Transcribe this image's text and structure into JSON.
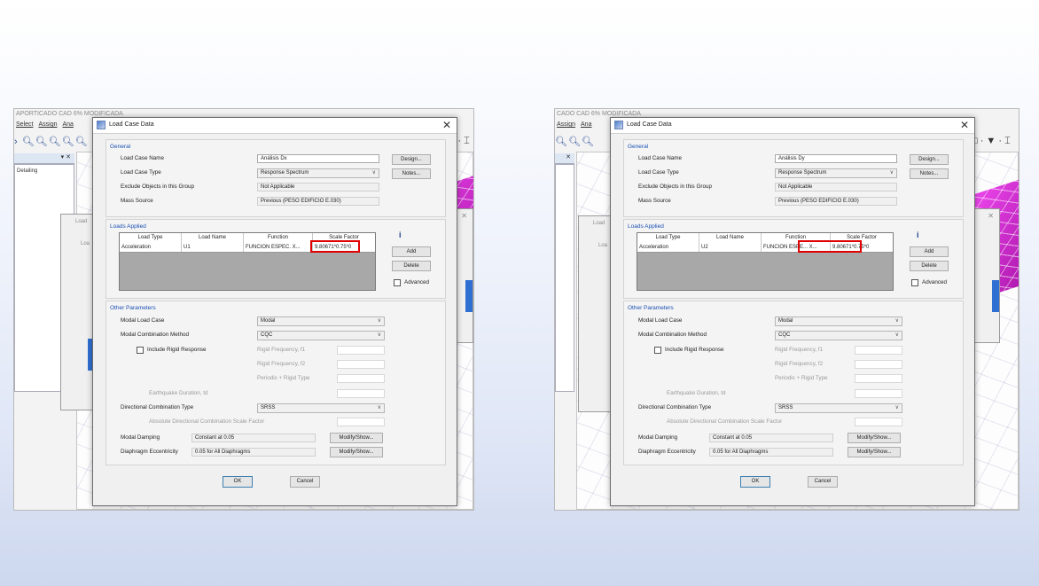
{
  "left": {
    "app": {
      "title": "APORTICADO CAD 6% MODIFICADA",
      "menu": [
        "Select",
        "Assign",
        "Ana"
      ],
      "panel_close": "▾ ✕",
      "tree_item": "Detailing",
      "toolbar_icons": "› 🔍︎🔍︎🔍︎🔍︎🔍︎",
      "toolbar_right": "□ · ▼ · ⌶ · ss",
      "bg_dialog_title": "Load",
      "bg_dialog_sub": "Loa"
    },
    "dialog": {
      "title": "Load Case Data",
      "close": "✕",
      "general": {
        "title": "General",
        "case_name_label": "Load Case Name",
        "case_name": "Análisis Dx",
        "case_type_label": "Load Case Type",
        "case_type": "Response Spectrum",
        "exclude_label": "Exclude Objects in this Group",
        "exclude_value": "Not Applicable",
        "mass_label": "Mass Source",
        "mass_value": "Previous (PESO EDIFICIO E.030)",
        "design_button": "Design...",
        "notes_button": "Notes..."
      },
      "loads": {
        "title": "Loads Applied",
        "headers": [
          "Load Type",
          "Load Name",
          "Function",
          "Scale Factor"
        ],
        "row": [
          "Acceleration",
          "U1",
          "FUNCION ESPEC. X...",
          "9.80671*0.75*0"
        ],
        "add_button": "Add",
        "delete_button": "Delete",
        "advanced_label": "Advanced",
        "info_icon": "i"
      },
      "other": {
        "title": "Other Parameters",
        "modal_case_label": "Modal Load Case",
        "modal_case": "Modal",
        "modal_comb_label": "Modal Combination Method",
        "modal_comb": "CQC",
        "rigid_label": "Include Rigid Response",
        "rigid_f1": "Rigid Frequency, f1",
        "rigid_f2": "Rigid Frequency, f2",
        "periodic_rigid": "Periodic + Rigid Type",
        "eq_duration": "Earthquake Duration, td",
        "dir_comb_label": "Directional Combination Type",
        "dir_comb": "SRSS",
        "abs_scale": "Absolute Directional Combination Scale Factor",
        "damping_label": "Modal Damping",
        "damping_value": "Constant at 0.05",
        "ecc_label": "Diaphragm Eccentricity",
        "ecc_value": "0.05 for All Diaphragms",
        "modify_button": "Modify/Show...",
        "modify_button2": "Modify/Show..."
      },
      "ok_button": "OK",
      "cancel_button": "Cancel"
    }
  },
  "right": {
    "app": {
      "title": "CADO CAD 6% MODIFICADA",
      "menu": [
        "Assign",
        "Ana"
      ],
      "panel_close": "✕",
      "toolbar_icons": "🔍︎🔍︎🔍︎",
      "toolbar_right": "□ · ▼ · ⌶",
      "bg_dialog_title": "Load",
      "bg_dialog_sub": "Loa"
    },
    "dialog": {
      "title": "Load Case Data",
      "close": "✕",
      "general": {
        "title": "General",
        "case_name_label": "Load Case Name",
        "case_name": "Análisis Dy",
        "case_type_label": "Load Case Type",
        "case_type": "Response Spectrum",
        "exclude_label": "Exclude Objects in this Group",
        "exclude_value": "Not Applicable",
        "mass_label": "Mass Source",
        "mass_value": "Previous (PESO EDIFICIO E.030)",
        "design_button": "Design...",
        "notes_button": "Notes..."
      },
      "loads": {
        "title": "Loads Applied",
        "headers": [
          "Load Type",
          "Load Name",
          "Function",
          "Scale Factor"
        ],
        "row": [
          "Acceleration",
          "U2",
          "FUNCION ESPE... X...",
          "9.80671*0.75*0"
        ],
        "add_button": "Add",
        "delete_button": "Delete",
        "advanced_label": "Advanced",
        "info_icon": "i"
      },
      "other": {
        "title": "Other Parameters",
        "modal_case_label": "Modal Load Case",
        "modal_case": "Modal",
        "modal_comb_label": "Modal Combination Method",
        "modal_comb": "CQC",
        "rigid_label": "Include Rigid Response",
        "rigid_f1": "Rigid Frequency, f1",
        "rigid_f2": "Rigid Frequency, f2",
        "periodic_rigid": "Periodic + Rigid Type",
        "eq_duration": "Earthquake Duration, td",
        "dir_comb_label": "Directional Combination Type",
        "dir_comb": "SRSS",
        "abs_scale": "Absolute Directional Combination Scale Factor",
        "damping_label": "Modal Damping",
        "damping_value": "Constant at 0.05",
        "ecc_label": "Diaphragm Eccentricity",
        "ecc_value": "0.05 for All Diaphragms",
        "modify_button": "Modify/Show...",
        "modify_button2": "Modify/Show..."
      },
      "ok_button": "OK",
      "cancel_button": "Cancel"
    }
  },
  "colors": {
    "highlight": "#e00000",
    "group_title": "#1a4fb3",
    "magenta_structure": "#d02cd0"
  }
}
